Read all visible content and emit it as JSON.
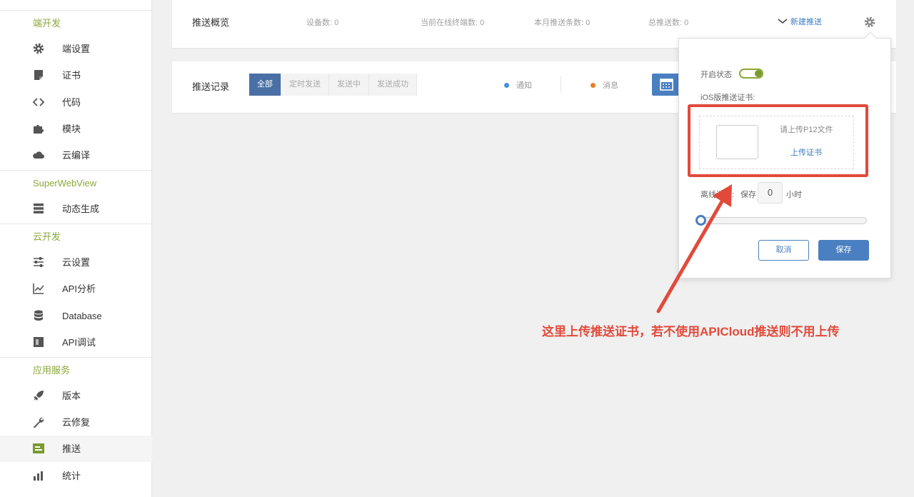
{
  "sidebar": {
    "sections": [
      {
        "title": "端开发",
        "items": [
          {
            "label": "端设置",
            "icon": "gear-icon"
          },
          {
            "label": "证书",
            "icon": "certificate-icon"
          },
          {
            "label": "代码",
            "icon": "code-icon"
          },
          {
            "label": "模块",
            "icon": "puzzle-icon"
          },
          {
            "label": "云编译",
            "icon": "cloud-icon"
          }
        ]
      },
      {
        "title": "SuperWebView",
        "items": [
          {
            "label": "动态生成",
            "icon": "layers-icon"
          }
        ]
      },
      {
        "title": "云开发",
        "items": [
          {
            "label": "云设置",
            "icon": "sliders-icon"
          },
          {
            "label": "API分析",
            "icon": "chart-line-icon"
          },
          {
            "label": "Database",
            "icon": "database-icon"
          },
          {
            "label": "API调试",
            "icon": "debug-icon"
          }
        ]
      },
      {
        "title": "应用服务",
        "items": [
          {
            "label": "版本",
            "icon": "rocket-icon"
          },
          {
            "label": "云修复",
            "icon": "wrench-icon"
          },
          {
            "label": "推送",
            "icon": "push-icon",
            "active": true
          },
          {
            "label": "统计",
            "icon": "bar-chart-icon"
          }
        ]
      }
    ]
  },
  "overview": {
    "title": "推送概览",
    "stats": [
      {
        "label": "设备数:",
        "value": "0"
      },
      {
        "label": "当前在线终端数:",
        "value": "0"
      },
      {
        "label": "本月推送条数:",
        "value": "0"
      },
      {
        "label": "总推送数:",
        "value": "0"
      }
    ],
    "new_push": "新建推送"
  },
  "records": {
    "title": "推送记录",
    "tabs": [
      "全部",
      "定时发送",
      "发送中",
      "发送成功"
    ],
    "legend": [
      {
        "label": "通知",
        "color": "#4a8fe0"
      },
      {
        "label": "消息",
        "color": "#f07c2a"
      }
    ]
  },
  "panel": {
    "status_label": "开启状态",
    "cert_label": "iOS版推送证书:",
    "upload_hint": "请上传P12文件",
    "upload_link": "上传证书",
    "offline_label": "离线消息:",
    "keep_label": "保存",
    "keep_value": "0",
    "keep_unit": "小时",
    "slider_fraction": 0.0,
    "cancel": "取消",
    "save": "保存"
  },
  "annotation": {
    "text": "这里上传推送证书，若不使用APICloud推送则不用上传",
    "color": "#e14a3b"
  },
  "colors": {
    "accent": "#4a7fc1",
    "section_green": "#8aa838"
  }
}
